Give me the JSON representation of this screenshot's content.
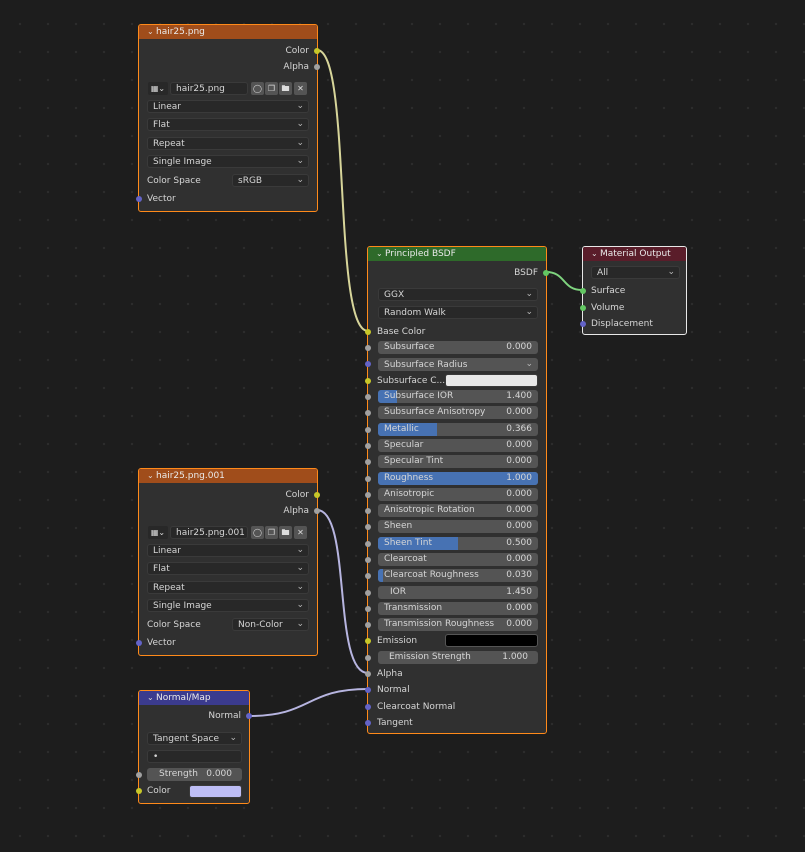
{
  "colors": {
    "image_header": "#a04d1b",
    "bsdf_header": "#2e6a2a",
    "output_header": "#5a1d2a",
    "normal_header": "#3b3b8e",
    "link_color": "#d7d59a",
    "link_vector": "#b7b5e0",
    "link_shader": "#7fd47f"
  },
  "image_node_1": {
    "title": "hair25.png",
    "outputs": [
      "Color",
      "Alpha"
    ],
    "image_name": "hair25.png",
    "interpolation": "Linear",
    "projection": "Flat",
    "extension": "Repeat",
    "source": "Single Image",
    "color_space_label": "Color Space",
    "color_space": "sRGB",
    "input": "Vector"
  },
  "image_node_2": {
    "title": "hair25.png.001",
    "outputs": [
      "Color",
      "Alpha"
    ],
    "image_name": "hair25.png.001",
    "interpolation": "Linear",
    "projection": "Flat",
    "extension": "Repeat",
    "source": "Single Image",
    "color_space_label": "Color Space",
    "color_space": "Non-Color",
    "input": "Vector"
  },
  "normal_map": {
    "title": "Normal/Map",
    "output": "Normal",
    "space": "Tangent Space",
    "uv_field": "•",
    "strength_label": "Strength",
    "strength_value": "0.000",
    "color_label": "Color",
    "color_swatch": "#bdbdf5"
  },
  "bsdf": {
    "title": "Principled BSDF",
    "output": "BSDF",
    "distribution": "GGX",
    "subsurface_method": "Random Walk",
    "base_color": "Base Color",
    "subsurface": {
      "label": "Subsurface",
      "value": "0.000",
      "fill": 0
    },
    "subsurface_radius": "Subsurface Radius",
    "subsurface_color": "Subsurface C...",
    "subsurface_color_swatch": "#e8e8e8",
    "sliders": [
      {
        "label": "Subsurface IOR",
        "value": "1.400",
        "fill": 0.12
      },
      {
        "label": "Subsurface Anisotropy",
        "value": "0.000",
        "fill": 0
      },
      {
        "label": "Metallic",
        "value": "0.366",
        "fill": 0.366
      },
      {
        "label": "Specular",
        "value": "0.000",
        "fill": 0
      },
      {
        "label": "Specular Tint",
        "value": "0.000",
        "fill": 0
      },
      {
        "label": "Roughness",
        "value": "1.000",
        "fill": 1.0
      },
      {
        "label": "Anisotropic",
        "value": "0.000",
        "fill": 0
      },
      {
        "label": "Anisotropic Rotation",
        "value": "0.000",
        "fill": 0
      },
      {
        "label": "Sheen",
        "value": "0.000",
        "fill": 0
      },
      {
        "label": "Sheen Tint",
        "value": "0.500",
        "fill": 0.5
      },
      {
        "label": "Clearcoat",
        "value": "0.000",
        "fill": 0
      },
      {
        "label": "Clearcoat Roughness",
        "value": "0.030",
        "fill": 0.03
      },
      {
        "label": "IOR",
        "value": "1.450",
        "fill": 0
      },
      {
        "label": "Transmission",
        "value": "0.000",
        "fill": 0
      },
      {
        "label": "Transmission Roughness",
        "value": "0.000",
        "fill": 0
      }
    ],
    "emission": "Emission",
    "emission_swatch": "#000000",
    "emission_strength": {
      "label": "Emission Strength",
      "value": "1.000"
    },
    "alpha": "Alpha",
    "normal": "Normal",
    "clearcoat_normal": "Clearcoat Normal",
    "tangent": "Tangent"
  },
  "material_output": {
    "title": "Material Output",
    "target": "All",
    "inputs": [
      "Surface",
      "Volume",
      "Displacement"
    ]
  }
}
